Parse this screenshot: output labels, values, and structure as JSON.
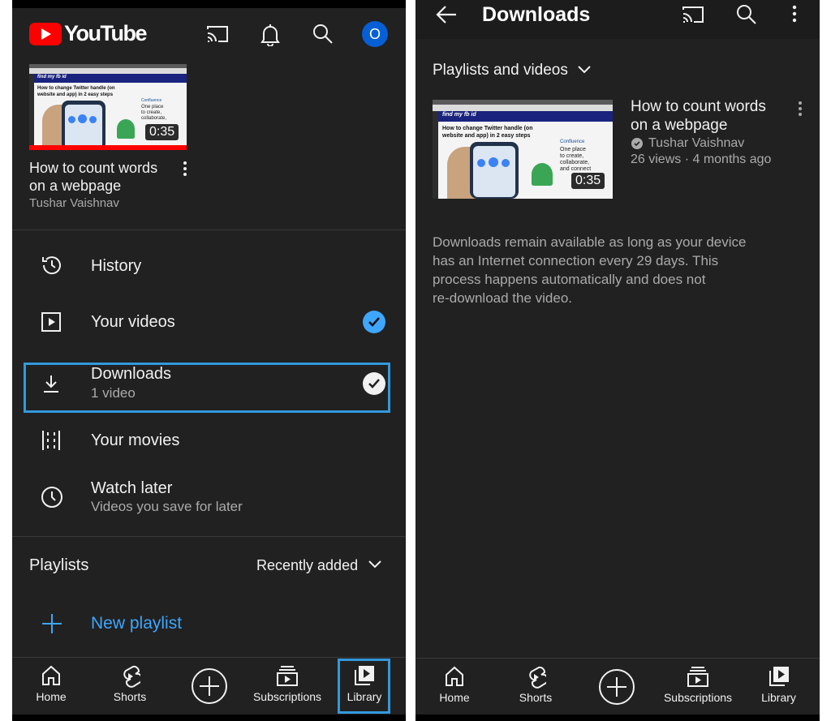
{
  "left": {
    "brand": {
      "logo_text": "YouTube",
      "avatar_letter": "O"
    },
    "recent_video": {
      "title_line1": "How to count words",
      "title_line2": "on a webpage",
      "channel": "Tushar Vaishnav",
      "duration": "0:35"
    },
    "library_items": [
      {
        "label": "History"
      },
      {
        "label": "Your videos"
      },
      {
        "label": "Downloads",
        "sublabel": "1 video"
      },
      {
        "label": "Your movies"
      },
      {
        "label": "Watch later",
        "sublabel": "Videos you save for later"
      }
    ],
    "playlists": {
      "heading": "Playlists",
      "sort_label": "Recently added",
      "new_playlist_label": "New playlist"
    }
  },
  "right": {
    "header_title": "Downloads",
    "filter_label": "Playlists and videos",
    "video": {
      "title_line1": "How to count words",
      "title_line2": "on a webpage",
      "channel": "Tushar Vaishnav",
      "meta": "26 views · 4 months ago",
      "duration": "0:35"
    },
    "info_lines": [
      "Downloads remain available as long as your device",
      "has an Internet connection every 29 days. This",
      "process happens automatically and does not",
      "re-download the video."
    ]
  },
  "thumbnail_text": {
    "site": "find my fb id",
    "headline_line1": "How to change Twitter handle (on",
    "headline_line2": "website and app) in 2 easy steps",
    "brand": "Confluence",
    "blurb1": "One place",
    "blurb2": "to create,",
    "blurb3": "collaborate,",
    "blurb4": "and connect"
  },
  "bottom_nav": [
    {
      "label": "Home"
    },
    {
      "label": "Shorts"
    },
    {
      "label": "Subscriptions"
    },
    {
      "label": "Library"
    }
  ],
  "colors": {
    "background": "#212121",
    "accent_blue": "#3ea6ff",
    "highlight_frame": "#3399dd",
    "youtube_red": "#ff0000",
    "avatar_blue": "#065fd4"
  }
}
